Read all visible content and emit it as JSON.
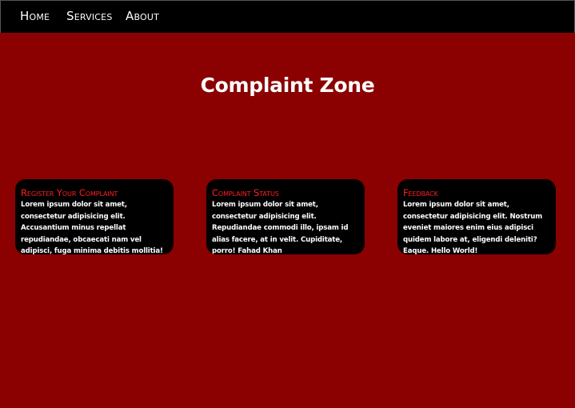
{
  "nav": {
    "items": [
      {
        "label": "Home"
      },
      {
        "label": "Services"
      },
      {
        "label": "About"
      }
    ]
  },
  "main": {
    "title": "Complaint Zone"
  },
  "cards": [
    {
      "title": "Register Your Complaint",
      "text": "Lorem ipsum dolor sit amet, consectetur adipisicing elit. Accusantium minus repellat repudiandae, obcaecati nam vel adipisci, fuga minima debitis mollitia!"
    },
    {
      "title": "Complaint Status",
      "text": "Lorem ipsum dolor sit amet, consectetur adipisicing elit. Repudiandae commodi illo, ipsam id alias facere, at in velit. Cupiditate, porro! Fahad Khan"
    },
    {
      "title": "Feedback",
      "text": "Lorem ipsum dolor sit amet, consectetur adipisicing elit. Nostrum eveniet maiores enim eius adipisci quidem labore at, eligendi deleniti? Eaque. Hello World!"
    }
  ],
  "colors": {
    "background": "#8b0000",
    "navbar": "#000000",
    "card": "#000000",
    "card_title": "#ff2020",
    "text": "#ffffff"
  }
}
